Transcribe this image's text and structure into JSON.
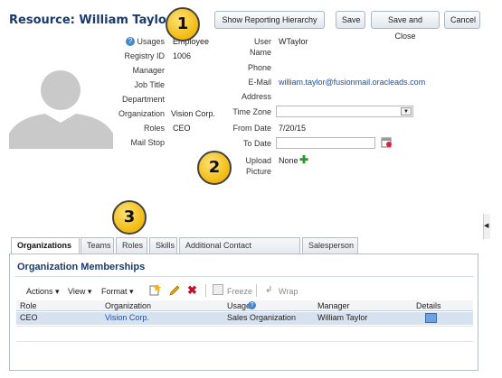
{
  "page": {
    "title": "Resource: William Taylor"
  },
  "toolbar": {
    "show_hierarchy": "Show Reporting Hierarchy",
    "save": "Save",
    "save_close": "Save and Close",
    "cancel": "Cancel"
  },
  "callouts": [
    "1",
    "2",
    "3"
  ],
  "left_fields": [
    {
      "label": "Usages",
      "value": "Employee"
    },
    {
      "label": "Registry ID",
      "value": "1006"
    },
    {
      "label": "Manager",
      "value": ""
    },
    {
      "label": "Job Title",
      "value": ""
    },
    {
      "label": "Department",
      "value": ""
    },
    {
      "label": "Organization",
      "value": "Vision Corp."
    },
    {
      "label": "Roles",
      "value": "CEO"
    },
    {
      "label": "Mail Stop",
      "value": ""
    }
  ],
  "right_fields": {
    "user_label": "User",
    "name_label": "Name",
    "user_name": "WTaylor",
    "phone_label": "Phone",
    "email_label": "E-Mail",
    "email": "william.taylor@fusionmail.oracleads.com",
    "address_label": "Address",
    "timezone_label": "Time Zone",
    "from_date_label": "From Date",
    "from_date": "7/20/15",
    "to_date_label": "To Date",
    "upload_label": "Upload",
    "picture_label": "Picture",
    "upload_value": "None"
  },
  "tabs": [
    {
      "label": "Organizations",
      "active": true
    },
    {
      "label": "Teams"
    },
    {
      "label": "Roles"
    },
    {
      "label": "Skills"
    },
    {
      "label": "Additional Contact Information"
    },
    {
      "label": "Salesperson"
    }
  ],
  "memberships": {
    "heading": "Organization Memberships",
    "menus": {
      "actions": "Actions",
      "view": "View",
      "format": "Format",
      "freeze": "Freeze",
      "wrap": "Wrap"
    },
    "columns": [
      "Role",
      "Organization",
      "Usage",
      "Manager",
      "Details"
    ],
    "rows": [
      {
        "role": "CEO",
        "organization": "Vision Corp.",
        "usage": "Sales Organization",
        "manager": "William Taylor"
      }
    ]
  },
  "colors": {
    "title": "#1a3a6e",
    "link": "#1b4fa6",
    "selected_row": "#d7e2f0",
    "callout": "#f1b90d"
  }
}
